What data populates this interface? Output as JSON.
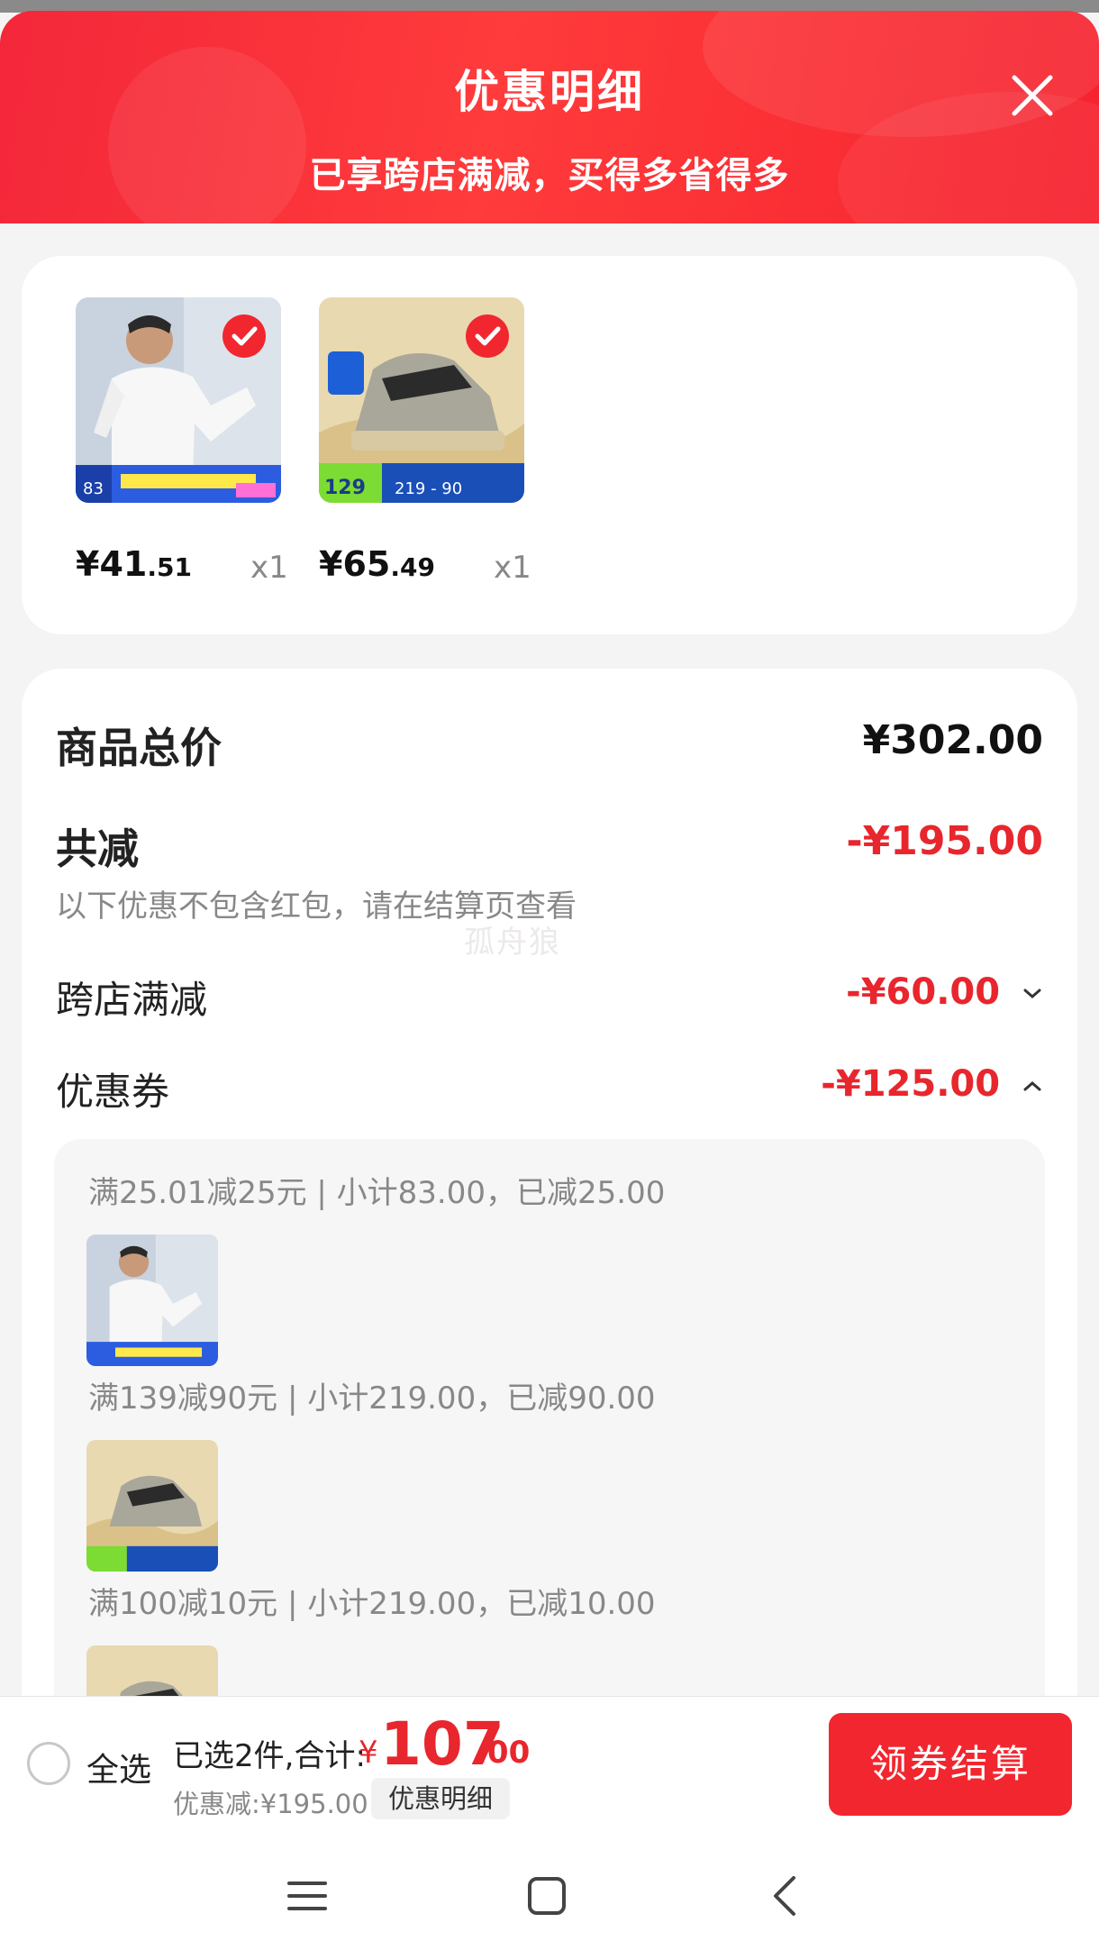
{
  "header": {
    "title": "优惠明细",
    "subtitle": "已享跨店满减，买得多省得多",
    "close_icon": "close-icon"
  },
  "products": [
    {
      "image": "white long-sleeve shirt product photo",
      "price_int": "¥41",
      "price_dec": ".51",
      "qty": "x1",
      "selected": true
    },
    {
      "image": "grey sneaker product photo",
      "price_int": "¥65",
      "price_dec": ".49",
      "qty": "x1",
      "selected": true
    }
  ],
  "summary": {
    "total_label": "商品总价",
    "total_value": "¥302.00",
    "reduce_label": "共减",
    "reduce_value": "-¥195.00",
    "note": "以下优惠不包含红包，请在结算页查看",
    "cross_store_label": "跨店满减",
    "cross_store_value": "-¥60.00",
    "coupon_label": "优惠券",
    "coupon_value": "-¥125.00"
  },
  "coupons": [
    {
      "text": "满25.01减25元 | 小计83.00，已减25.00",
      "thumb": "shirt"
    },
    {
      "text": "满139减90元 | 小计219.00，已减90.00",
      "thumb": "sneaker"
    },
    {
      "text": "满100减10元 | 小计219.00，已减10.00",
      "thumb": "sneaker"
    }
  ],
  "watermark": "孤舟狼",
  "bottom": {
    "select_all": "全选",
    "selected_prefix": "已选2件,合计:",
    "yen": "¥",
    "total_int": "107",
    "total_dec": ".00",
    "discount_line": "优惠减:¥195.00",
    "detail_button": "优惠明细",
    "checkout_button": "领券结算"
  },
  "nav": [
    "menu-icon",
    "home-square-icon",
    "back-icon"
  ],
  "colors": {
    "accent": "#e8262d",
    "header": "#f5232f",
    "background": "#f4f4f4"
  }
}
